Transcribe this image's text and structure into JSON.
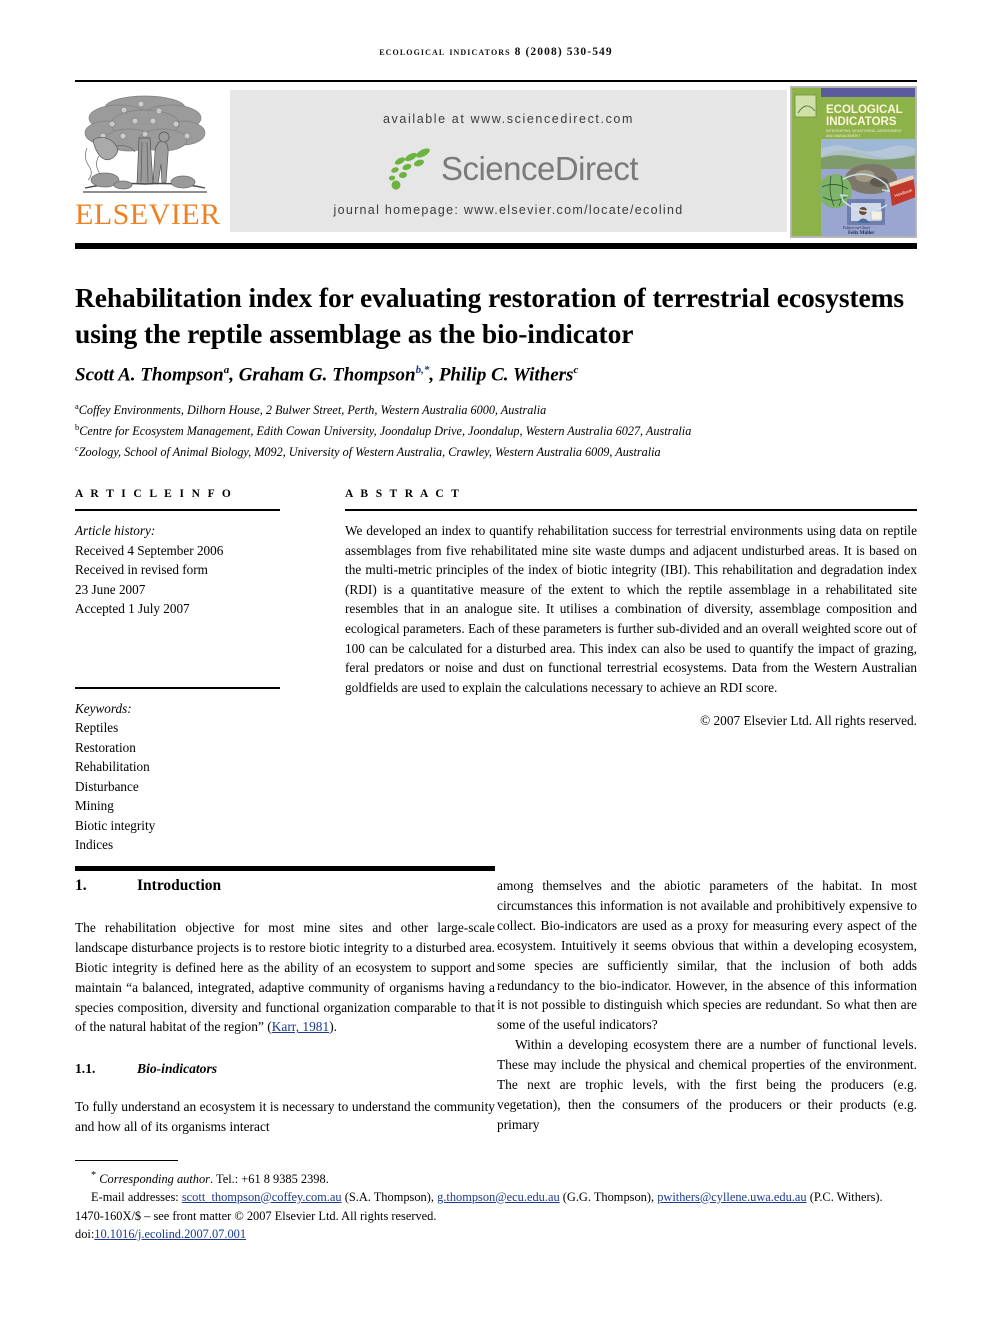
{
  "running_head": "ECOLOGICAL INDICATORS 8 (2008) 530-549",
  "masthead": {
    "publisher": "ELSEVIER",
    "available_at": "available at www.sciencedirect.com",
    "sciencedirect_wordmark": "ScienceDirect",
    "journal_homepage": "journal homepage: www.elsevier.com/locate/ecolind",
    "cover": {
      "journal_name_line1": "ECOLOGICAL",
      "journal_name_line2": "INDICATORS",
      "subtitle": "INTEGRATING, MONITORING, ASSESSMENT AND MANAGEMENT",
      "editor_label": "Editor-in-Chief",
      "editor_name": "Felix Müller",
      "colors": {
        "header_purple": "#6a6ab0",
        "panel_green": "#8db24a",
        "title_cream": "#fdf6d8"
      }
    }
  },
  "article": {
    "title": "Rehabilitation index for evaluating restoration of terrestrial ecosystems using the reptile assemblage as the bio-indicator",
    "authors": [
      {
        "name": "Scott A. Thompson",
        "marks": "a"
      },
      {
        "name": "Graham G. Thompson",
        "marks": "b,*"
      },
      {
        "name": "Philip C. Withers",
        "marks": "c"
      }
    ],
    "affiliations": [
      {
        "mark": "a",
        "text": "Coffey Environments, Dilhorn House, 2 Bulwer Street, Perth, Western Australia 6000, Australia"
      },
      {
        "mark": "b",
        "text": "Centre for Ecosystem Management, Edith Cowan University, Joondalup Drive, Joondalup, Western Australia 6027, Australia"
      },
      {
        "mark": "c",
        "text": "Zoology, School of Animal Biology, M092, University of Western Australia, Crawley, Western Australia 6009, Australia"
      }
    ]
  },
  "article_info": {
    "heading": "A R T I C L E  I N F O",
    "history_label": "Article history:",
    "history": [
      "Received 4 September 2006",
      "Received in revised form",
      "23 June 2007",
      "Accepted 1 July 2007"
    ],
    "keywords_label": "Keywords:",
    "keywords": [
      "Reptiles",
      "Restoration",
      "Rehabilitation",
      "Disturbance",
      "Mining",
      "Biotic integrity",
      "Indices"
    ]
  },
  "abstract": {
    "heading": "A B S T R A C T",
    "text": "We developed an index to quantify rehabilitation success for terrestrial environments using data on reptile assemblages from five rehabilitated mine site waste dumps and adjacent undisturbed areas. It is based on the multi-metric principles of the index of biotic integrity (IBI). This rehabilitation and degradation index (RDI) is a quantitative measure of the extent to which the reptile assemblage in a rehabilitated site resembles that in an analogue site. It utilises a combination of diversity, assemblage composition and ecological parameters. Each of these parameters is further sub-divided and an overall weighted score out of 100 can be calculated for a disturbed area. This index can also be used to quantify the impact of grazing, feral predators or noise and dust on functional terrestrial ecosystems. Data from the Western Australian goldfields are used to explain the calculations necessary to achieve an RDI score.",
    "copyright": "© 2007 Elsevier Ltd. All rights reserved."
  },
  "body": {
    "section1_number": "1.",
    "section1_title": "Introduction",
    "section1_para1_a": "The rehabilitation objective for most mine sites and other large-scale landscape disturbance projects is to restore biotic integrity to a disturbed area. Biotic integrity is defined here as the ability of an ecosystem to support and maintain “a balanced, integrated, adaptive community of organisms having a species composition, diversity and functional organization comparable to that of the natural habitat of the region” (",
    "section1_para1_cite": "Karr, 1981",
    "section1_para1_b": ").",
    "section11_number": "1.1.",
    "section11_title": "Bio-indicators",
    "section11_para1": "To fully understand an ecosystem it is necessary to understand the community and how all of its organisms interact",
    "right_para1": "among themselves and the abiotic parameters of the habitat. In most circumstances this information is not available and prohibitively expensive to collect. Bio-indicators are used as a proxy for measuring every aspect of the ecosystem. Intuitively it seems obvious that within a developing ecosystem, some species are sufficiently similar, that the inclusion of both adds redundancy to the bio-indicator. However, in the absence of this information it is not possible to distinguish which species are redundant. So what then are some of the useful indicators?",
    "right_para2": "Within a developing ecosystem there are a number of functional levels. These may include the physical and chemical properties of the environment. The next are trophic levels, with the first being the producers (e.g. vegetation), then the consumers of the producers or their products (e.g. primary"
  },
  "footnotes": {
    "corresponding_mark": "*",
    "corresponding_label": "Corresponding author",
    "corresponding_tel": ". Tel.: +61 8 9385 2398.",
    "email_label": "E-mail addresses:",
    "emails": [
      {
        "address": "scott_thompson@coffey.com.au",
        "owner": "(S.A. Thompson),"
      },
      {
        "address": "g.thompson@ecu.edu.au",
        "owner": "(G.G. Thompson),"
      },
      {
        "address": "pwithers@cyllene.uwa.edu.au",
        "owner": "(P.C. Withers)."
      }
    ],
    "front_matter": "1470-160X/$ – see front matter © 2007 Elsevier Ltd. All rights reserved.",
    "doi_label": "doi:",
    "doi_value": "10.1016/j.ecolind.2007.07.001"
  }
}
